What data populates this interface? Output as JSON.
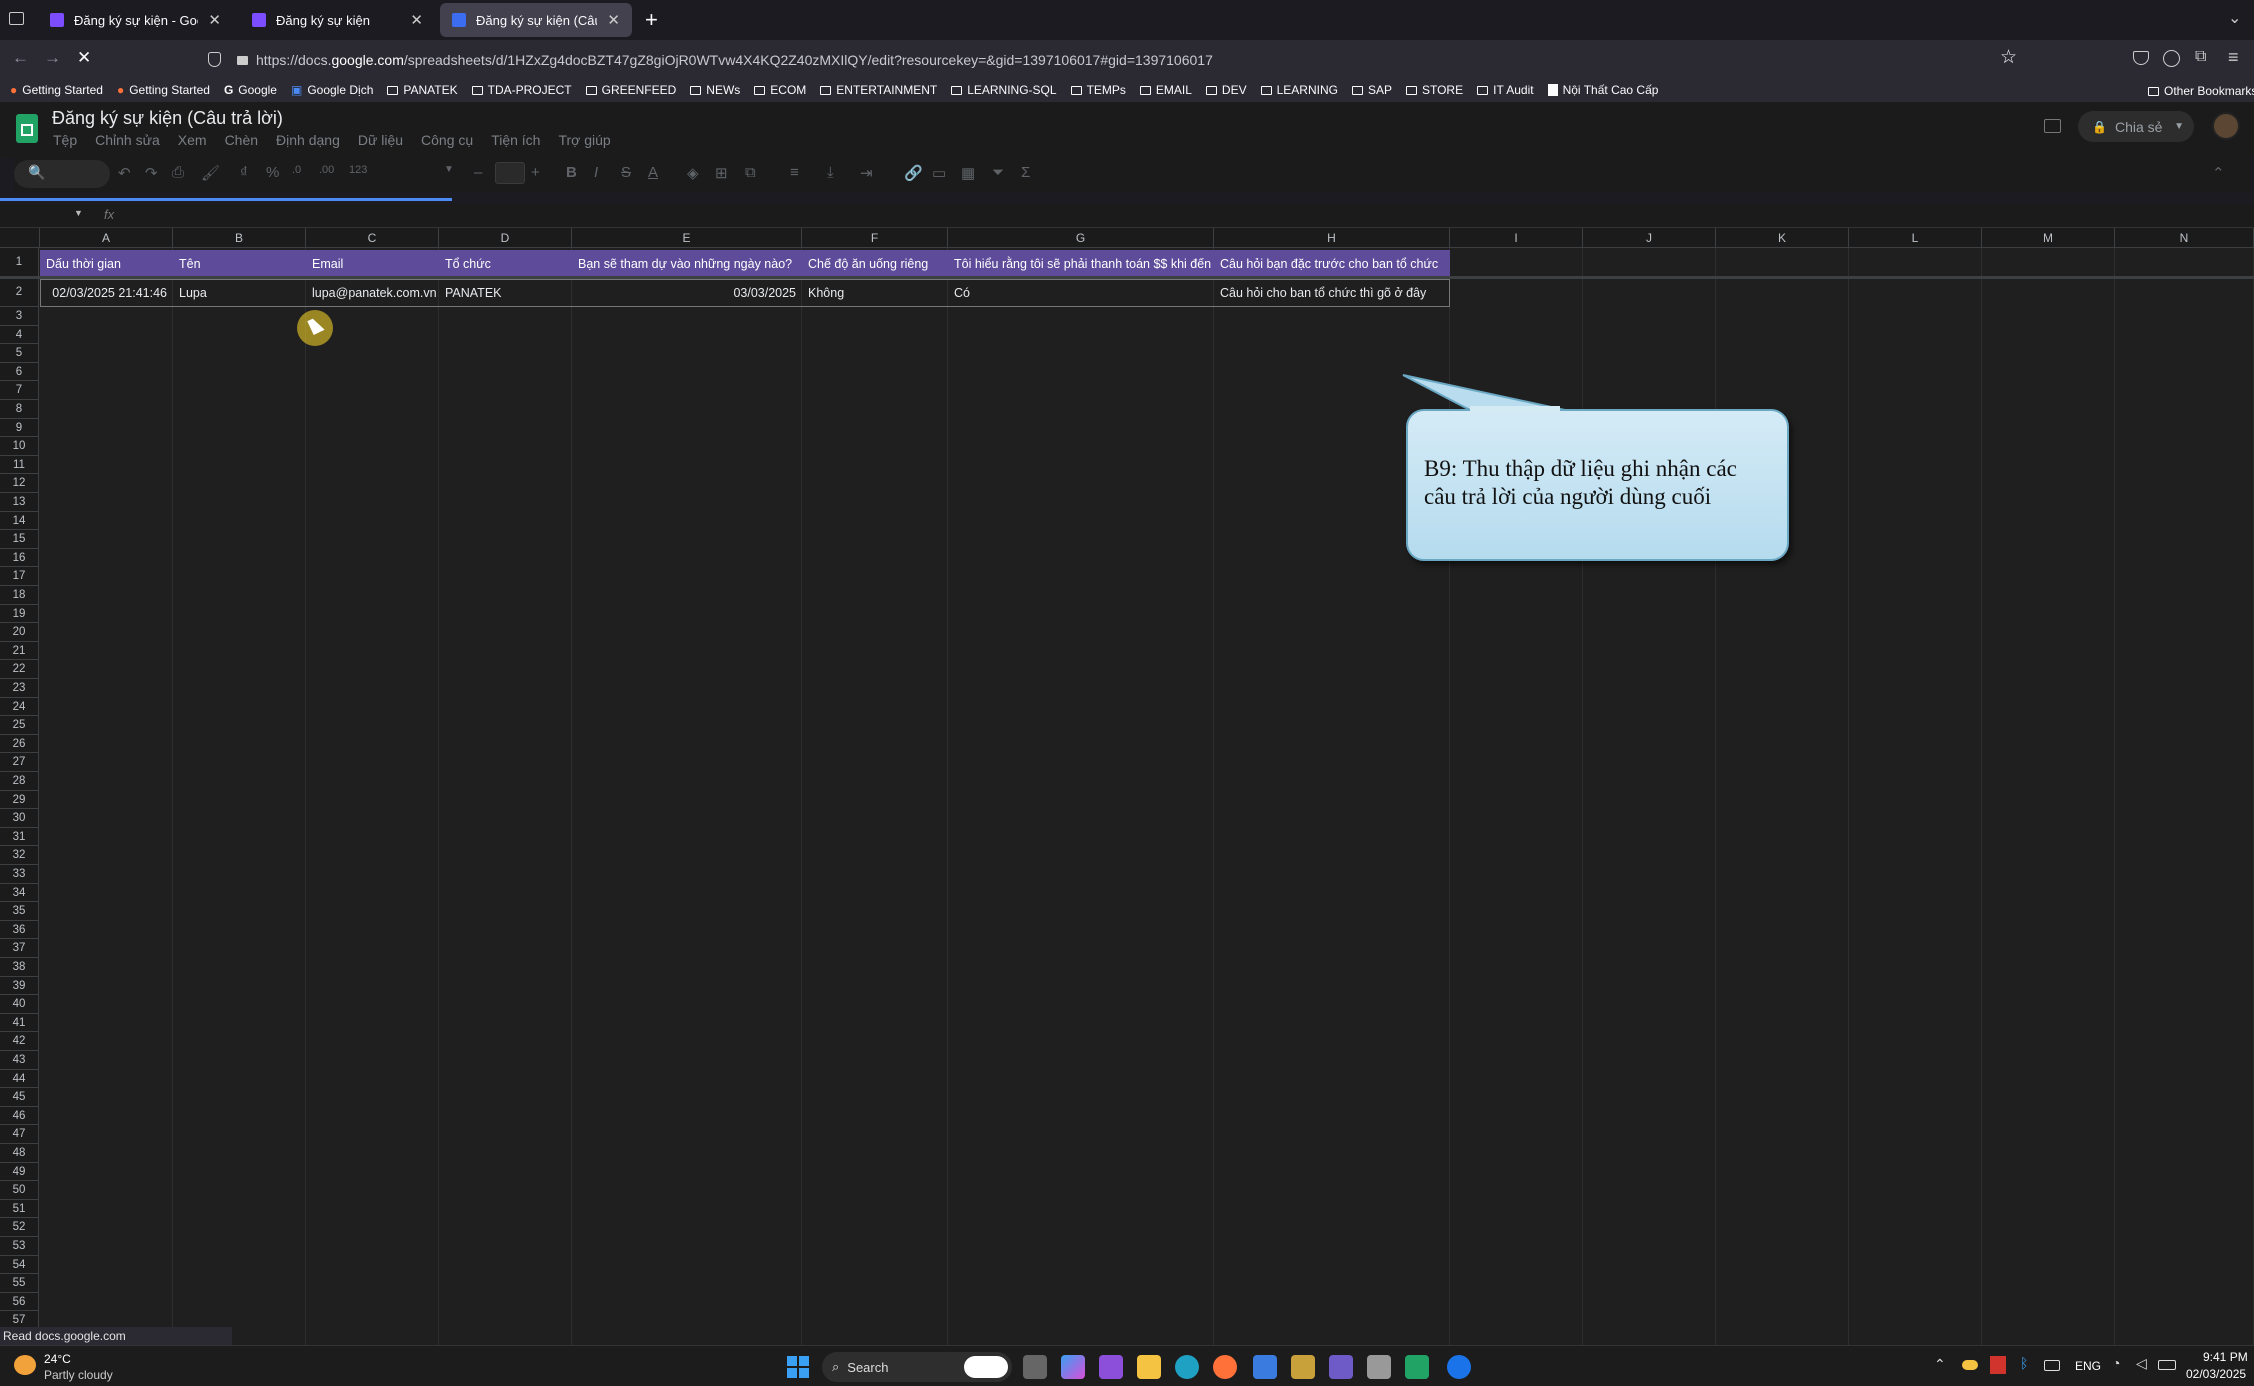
{
  "browser": {
    "tabs": [
      {
        "title": "Đăng ký sự kiện - Google Biểu",
        "close": "✕"
      },
      {
        "title": "Đăng ký sự kiện",
        "close": "✕"
      },
      {
        "title": "Đăng ký sự kiện (Câu trả lời) - G",
        "close": "✕"
      }
    ],
    "new_tab": "+",
    "url_prefix": "https://docs.",
    "url_domain": "google.com",
    "url_rest": "/spreadsheets/d/1HZxZg4docBZT47gZ8giOjR0WTvw4X4KQ2Z40zMXIlQY/edit?resourcekey=&gid=1397106017#gid=1397106017",
    "bookmarks": [
      "Getting Started",
      "Getting Started",
      "Google",
      "Google Dịch",
      "PANATEK",
      "TDA-PROJECT",
      "GREENFEED",
      "NEWs",
      "ECOM",
      "ENTERTAINMENT",
      "LEARNING-SQL",
      "TEMPs",
      "EMAIL",
      "DEV",
      "LEARNING",
      "SAP",
      "STORE",
      "IT Audit",
      "Nội Thất Cao Cấp"
    ],
    "other_bookmarks": "Other Bookmarks",
    "status": "Read docs.google.com"
  },
  "sheet": {
    "title": "Đăng ký sự kiện (Câu trả lời)",
    "menu": [
      "Tệp",
      "Chỉnh sửa",
      "Xem",
      "Chèn",
      "Định dạng",
      "Dữ liệu",
      "Công cụ",
      "Tiện ích",
      "Trợ giúp"
    ],
    "share_label": "Chia sẻ",
    "fx": "fx",
    "columns": [
      "A",
      "B",
      "C",
      "D",
      "E",
      "F",
      "G",
      "H",
      "I",
      "J",
      "K",
      "L",
      "M",
      "N"
    ],
    "header_row": [
      "Dấu thời gian",
      "Tên",
      "Email",
      "Tổ chức",
      "Bạn sẽ tham dự vào những ngày nào?",
      "Chế độ ăn uống riêng",
      "Tôi hiểu rằng tôi sẽ phải thanh toán $$ khi đến nơi",
      "Câu hỏi bạn đặc trước cho ban tổ chức"
    ],
    "data_row": [
      "02/03/2025 21:41:46",
      "Lupa",
      "lupa@panatek.com.vn",
      "PANATEK",
      "03/03/2025",
      "Không",
      "Có",
      "Câu hỏi cho ban tổ chức thì gõ ở đây"
    ],
    "row_count": 57
  },
  "callout": {
    "text": "B9: Thu thập dữ liệu ghi nhận các câu trả lời của người dùng cuối"
  },
  "taskbar": {
    "weather_temp": "24°C",
    "weather_desc": "Partly cloudy",
    "search": "Search",
    "lang": "ENG",
    "time": "9:41 PM",
    "date": "02/03/2025"
  },
  "colors": {
    "header_fill": "#5e4b9a",
    "callout": "#c6e3f2"
  }
}
